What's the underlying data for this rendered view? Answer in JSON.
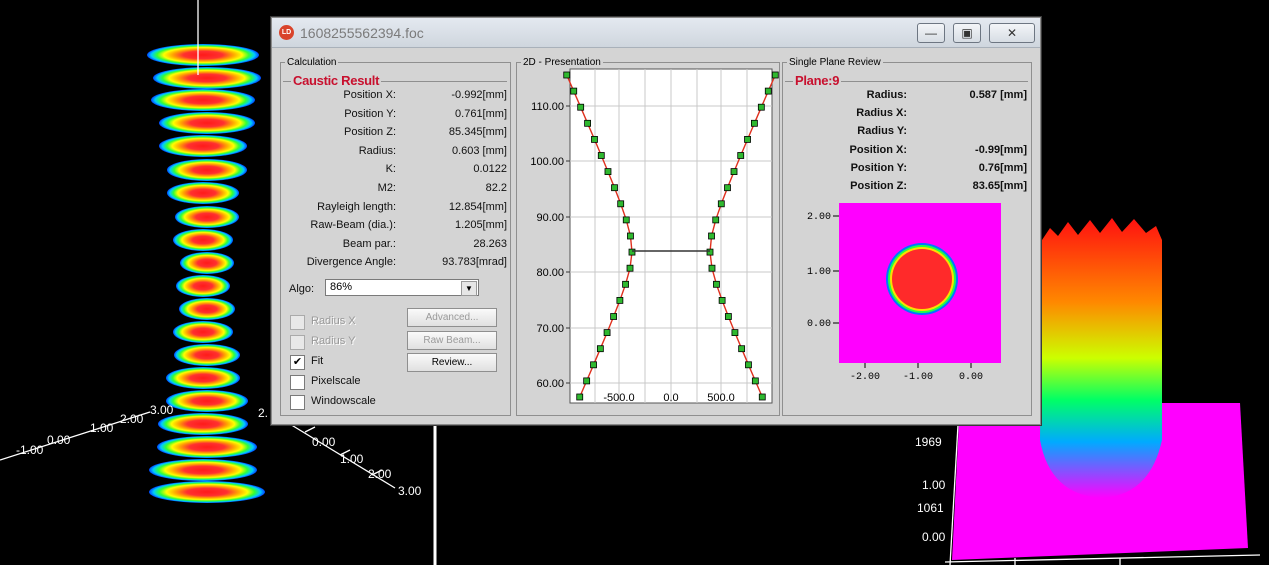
{
  "window": {
    "title": "1608255562394.foc",
    "app_badge": "LD",
    "controls": [
      "minimize-icon",
      "restore-icon",
      "close-icon"
    ]
  },
  "calculation": {
    "panel_title": "Calculation",
    "section_title": "Caustic Result",
    "rows": [
      {
        "label": "Position X:",
        "value": "-0.992[mm]"
      },
      {
        "label": "Position Y:",
        "value": "0.761[mm]"
      },
      {
        "label": "Position Z:",
        "value": "85.345[mm]"
      },
      {
        "label": "Radius:",
        "value": "0.603 [mm]"
      },
      {
        "label": "K:",
        "value": "0.0122"
      },
      {
        "label": "M2:",
        "value": "82.2"
      },
      {
        "label": "Rayleigh length:",
        "value": "12.854[mm]"
      },
      {
        "label": "Raw-Beam (dia.):",
        "value": "1.205[mm]"
      },
      {
        "label": "Beam par.:",
        "value": "28.263"
      },
      {
        "label": "Divergence Angle:",
        "value": "93.783[mrad]"
      }
    ],
    "algo_label": "Algo:",
    "algo_value": "86%",
    "checkboxes": [
      {
        "label": "Radius X",
        "checked": false,
        "enabled": false
      },
      {
        "label": "Radius Y",
        "checked": false,
        "enabled": false
      },
      {
        "label": "Fit",
        "checked": true,
        "enabled": true
      },
      {
        "label": "Pixelscale",
        "checked": false,
        "enabled": true
      },
      {
        "label": "Windowscale",
        "checked": false,
        "enabled": true
      }
    ],
    "buttons": {
      "advanced": "Advanced...",
      "raw_beam": "Raw Beam...",
      "review": "Review..."
    }
  },
  "presentation": {
    "panel_title": "2D - Presentation",
    "y_ticks": [
      "110.00",
      "100.00",
      "90.00",
      "80.00",
      "70.00",
      "60.00"
    ],
    "x_ticks": [
      "-500.0",
      "0.0",
      "500.0"
    ]
  },
  "single_plane": {
    "panel_title": "Single Plane Review",
    "section_title": "Plane:9",
    "rows": [
      {
        "label": "Radius:",
        "value": "0.587 [mm]"
      },
      {
        "label": "Radius X:",
        "value": ""
      },
      {
        "label": "Radius Y:",
        "value": ""
      },
      {
        "label": "Position X:",
        "value": "-0.99[mm]"
      },
      {
        "label": "Position Y:",
        "value": "0.76[mm]"
      },
      {
        "label": "Position Z:",
        "value": "83.65[mm]"
      }
    ],
    "y_ticks": [
      "2.00",
      "1.00",
      "0.00"
    ],
    "x_ticks": [
      "-2.00",
      "-1.00",
      "0.00"
    ]
  },
  "background": {
    "left_axis_labels": [
      "-1.00",
      "0.00",
      "1.00",
      "2.00",
      "3.00",
      "2.",
      "0.00",
      "1.00",
      "2.00",
      "3.00"
    ],
    "right_axis_labels": [
      "1969",
      "1.00",
      "1061",
      "0.00"
    ]
  },
  "colors": {
    "accent_red": "#c8102e",
    "panel_bg": "#d4d4d4",
    "plot_bg": "#ff00ff"
  }
}
